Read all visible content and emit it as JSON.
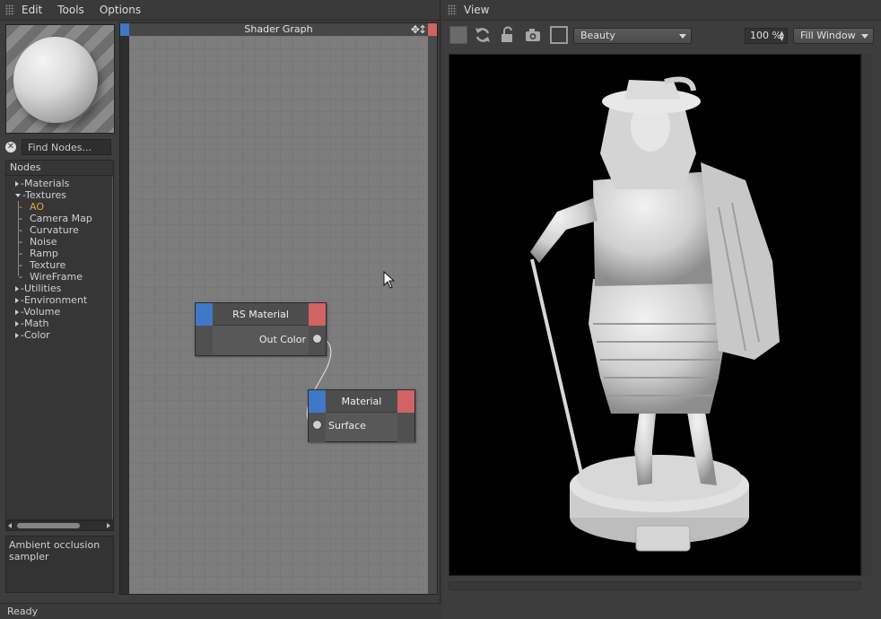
{
  "menu": {
    "edit": "Edit",
    "tools": "Tools",
    "options": "Options"
  },
  "search": {
    "placeholder": "Find Nodes..."
  },
  "nodes_panel": {
    "header": "Nodes",
    "items": [
      {
        "label": "Materials",
        "expanded": false
      },
      {
        "label": "Textures",
        "expanded": true
      },
      {
        "label": "AO",
        "selected": true
      },
      {
        "label": "Camera Map"
      },
      {
        "label": "Curvature"
      },
      {
        "label": "Noise"
      },
      {
        "label": "Ramp"
      },
      {
        "label": "Texture"
      },
      {
        "label": "WireFrame"
      },
      {
        "label": "Utilities",
        "expanded": false
      },
      {
        "label": "Environment",
        "expanded": false
      },
      {
        "label": "Volume",
        "expanded": false
      },
      {
        "label": "Math",
        "expanded": false
      },
      {
        "label": "Color",
        "expanded": false
      }
    ]
  },
  "description": "Ambient occlusion sampler",
  "status": "Ready",
  "graph": {
    "title": "Shader Graph",
    "nodes": [
      {
        "title": "RS Material",
        "port": "Out Color"
      },
      {
        "title": "Material",
        "port": "Surface"
      }
    ]
  },
  "view": {
    "title": "View",
    "aov": "Beauty",
    "zoom": "100 %",
    "fit": "Fill Window"
  },
  "colors": {
    "accent_selected": "#e8a23a",
    "input_port": "#3f78c4",
    "output_port": "#d26363",
    "panel_bg": "#3d3d3d",
    "graph_bg": "#7d7d7d"
  }
}
